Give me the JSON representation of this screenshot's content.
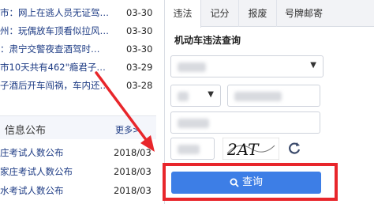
{
  "news": [
    {
      "title": "市：网上在逃人员无证驾…",
      "date": "03-30"
    },
    {
      "title": "州：玩偶放车顶看似拉风…",
      "date": "03-30"
    },
    {
      "title": "：肃宁交警夜查酒驾时…",
      "date": "03-30"
    },
    {
      "title": "市10天共有462\"瘾君子…",
      "date": "03-29"
    },
    {
      "title": "子酒后开车闯祸，车内还…",
      "date": "03-28"
    }
  ],
  "info": {
    "title": "信息公布",
    "more": "更多>",
    "items": [
      {
        "title": "庄考试人数公布",
        "date": "2018/03"
      },
      {
        "title": "家庄考试人数公布",
        "date": "2018/03"
      },
      {
        "title": "水考试人数公布",
        "date": "2018/03"
      }
    ]
  },
  "tabs": [
    {
      "label": "违法",
      "active": true
    },
    {
      "label": "记分",
      "active": false
    },
    {
      "label": "报废",
      "active": false
    },
    {
      "label": "号牌邮寄",
      "active": false
    }
  ],
  "form": {
    "title": "机动车违法查询",
    "plate_prefix": "冀",
    "captcha_text": "2AT"
  },
  "search_button": "查询",
  "colors": {
    "accent": "#3d7ee6",
    "highlight": "#e8262b",
    "link": "#1d3b84"
  },
  "icons": [
    "search-icon",
    "refresh-icon",
    "caret-down-icon",
    "arrow-annotation"
  ]
}
